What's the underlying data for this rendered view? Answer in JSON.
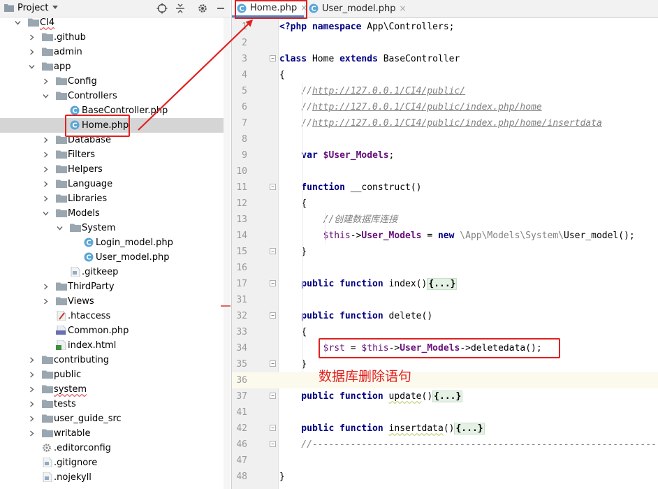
{
  "project_panel": {
    "title": "Project",
    "tree": [
      {
        "label": "CI4",
        "level": 1,
        "type": "folder",
        "arrow": "down",
        "wavy": true
      },
      {
        "label": ".github",
        "level": 2,
        "type": "folder",
        "arrow": "right"
      },
      {
        "label": "admin",
        "level": 2,
        "type": "folder",
        "arrow": "right"
      },
      {
        "label": "app",
        "level": 2,
        "type": "folder",
        "arrow": "down"
      },
      {
        "label": "Config",
        "level": 3,
        "type": "folder",
        "arrow": "right"
      },
      {
        "label": "Controllers",
        "level": 3,
        "type": "folder",
        "arrow": "down"
      },
      {
        "label": "BaseController.php",
        "level": 4,
        "type": "php-class"
      },
      {
        "label": "Home.php",
        "level": 4,
        "type": "php-class",
        "selected": true
      },
      {
        "label": "Database",
        "level": 3,
        "type": "folder",
        "arrow": "right"
      },
      {
        "label": "Filters",
        "level": 3,
        "type": "folder",
        "arrow": "right"
      },
      {
        "label": "Helpers",
        "level": 3,
        "type": "folder",
        "arrow": "right"
      },
      {
        "label": "Language",
        "level": 3,
        "type": "folder",
        "arrow": "right"
      },
      {
        "label": "Libraries",
        "level": 3,
        "type": "folder",
        "arrow": "right"
      },
      {
        "label": "Models",
        "level": 3,
        "type": "folder",
        "arrow": "down"
      },
      {
        "label": "System",
        "level": 4,
        "type": "folder",
        "arrow": "down"
      },
      {
        "label": "Login_model.php",
        "level": 5,
        "type": "php-class"
      },
      {
        "label": "User_model.php",
        "level": 5,
        "type": "php-class"
      },
      {
        "label": ".gitkeep",
        "level": 4,
        "type": "file"
      },
      {
        "label": "ThirdParty",
        "level": 3,
        "type": "folder",
        "arrow": "right"
      },
      {
        "label": "Views",
        "level": 3,
        "type": "folder",
        "arrow": "right"
      },
      {
        "label": ".htaccess",
        "level": 3,
        "type": "htaccess"
      },
      {
        "label": "Common.php",
        "level": 3,
        "type": "php-file"
      },
      {
        "label": "index.html",
        "level": 3,
        "type": "html-file"
      },
      {
        "label": "contributing",
        "level": 2,
        "type": "folder",
        "arrow": "right"
      },
      {
        "label": "public",
        "level": 2,
        "type": "folder",
        "arrow": "right"
      },
      {
        "label": "system",
        "level": 2,
        "type": "folder",
        "arrow": "right",
        "wavy": true
      },
      {
        "label": "tests",
        "level": 2,
        "type": "folder",
        "arrow": "right"
      },
      {
        "label": "user_guide_src",
        "level": 2,
        "type": "folder",
        "arrow": "right"
      },
      {
        "label": "writable",
        "level": 2,
        "type": "folder",
        "arrow": "right"
      },
      {
        "label": ".editorconfig",
        "level": 2,
        "type": "config"
      },
      {
        "label": ".gitignore",
        "level": 2,
        "type": "file"
      },
      {
        "label": ".nojekyll",
        "level": 2,
        "type": "file"
      }
    ]
  },
  "editor": {
    "tabs": [
      {
        "label": "Home.php",
        "active": true
      },
      {
        "label": "User_model.php",
        "active": false
      }
    ],
    "close_glyph": "×",
    "lines": [
      {
        "n": "1",
        "tokens": [
          [
            "kw",
            "<?php"
          ],
          [
            "",
            ""
          ],
          [
            "kw",
            " namespace"
          ],
          [
            "",
            " App\\Controllers;"
          ]
        ]
      },
      {
        "n": "2",
        "tokens": []
      },
      {
        "n": "3",
        "tokens": [
          [
            "kw",
            "class"
          ],
          [
            "",
            " Home "
          ],
          [
            "kw",
            "extends"
          ],
          [
            "",
            " BaseController"
          ]
        ],
        "fold": true
      },
      {
        "n": "4",
        "tokens": [
          [
            "",
            "{"
          ]
        ]
      },
      {
        "n": "5",
        "tokens": [
          [
            "cmt",
            "    //"
          ],
          [
            "cmt-url",
            "http://127.0.0.1/CI4/public/"
          ]
        ]
      },
      {
        "n": "6",
        "tokens": [
          [
            "cmt",
            "    //"
          ],
          [
            "cmt-url",
            "http://127.0.0.1/CI4/public/index.php/home"
          ]
        ]
      },
      {
        "n": "7",
        "tokens": [
          [
            "cmt",
            "    //"
          ],
          [
            "cmt-url",
            "http://127.0.0.1/CI4/public/index.php/home/insertdata"
          ]
        ]
      },
      {
        "n": "8",
        "tokens": []
      },
      {
        "n": "9",
        "tokens": [
          [
            "kw",
            "    var"
          ],
          [
            "",
            " "
          ],
          [
            "var-b",
            "$User_Models"
          ],
          [
            "",
            ";"
          ]
        ]
      },
      {
        "n": "10",
        "tokens": []
      },
      {
        "n": "11",
        "tokens": [
          [
            "kw",
            "    function"
          ],
          [
            "",
            " __construct()"
          ]
        ],
        "fold": true
      },
      {
        "n": "12",
        "tokens": [
          [
            "",
            "    {"
          ]
        ]
      },
      {
        "n": "13",
        "tokens": [
          [
            "cmt",
            "        //创建数据库连接"
          ]
        ]
      },
      {
        "n": "14",
        "tokens": [
          [
            "var",
            "        $this"
          ],
          [
            "",
            "->"
          ],
          [
            "prop",
            "User_Models"
          ],
          [
            "",
            " = "
          ],
          [
            "kw",
            "new"
          ],
          [
            "",
            " "
          ],
          [
            "plain-gray",
            "\\App\\Models\\System\\"
          ],
          [
            "",
            "User_model();"
          ]
        ]
      },
      {
        "n": "15",
        "tokens": [
          [
            "",
            "    }"
          ]
        ],
        "fold": true
      },
      {
        "n": "16",
        "tokens": []
      },
      {
        "n": "17",
        "tokens": [
          [
            "kw",
            "    public function"
          ],
          [
            "",
            " index()"
          ],
          [
            "fold-box",
            "{...}"
          ]
        ],
        "fold": true
      },
      {
        "n": "31",
        "tokens": []
      },
      {
        "n": "32",
        "tokens": [
          [
            "kw",
            "    public function"
          ],
          [
            "",
            " delete()"
          ]
        ],
        "fold": true
      },
      {
        "n": "33",
        "tokens": [
          [
            "",
            "    {"
          ]
        ]
      },
      {
        "n": "34",
        "tokens": [
          [
            "",
            "        "
          ],
          [
            "var",
            "$rst"
          ],
          [
            "",
            " = "
          ],
          [
            "var",
            "$this"
          ],
          [
            "",
            "->"
          ],
          [
            "prop",
            "User_Models"
          ],
          [
            "",
            "->deletedata();"
          ]
        ]
      },
      {
        "n": "35",
        "tokens": [
          [
            "",
            "    }"
          ]
        ],
        "fold": true
      },
      {
        "n": "36",
        "tokens": [],
        "current": true
      },
      {
        "n": "37",
        "tokens": [
          [
            "kw",
            "    public function"
          ],
          [
            "",
            " "
          ],
          [
            "unused",
            "update"
          ],
          [
            "",
            "()"
          ],
          [
            "fold-box",
            "{...}"
          ]
        ],
        "fold": true
      },
      {
        "n": "41",
        "tokens": []
      },
      {
        "n": "42",
        "tokens": [
          [
            "kw",
            "    public function"
          ],
          [
            "",
            " "
          ],
          [
            "unused",
            "insertdata"
          ],
          [
            "",
            "()"
          ],
          [
            "fold-box",
            "{...}"
          ]
        ],
        "fold": true
      },
      {
        "n": "46",
        "tokens": [
          [
            "cmt",
            "    //----------------------------------------------------------------"
          ]
        ],
        "fold": true
      },
      {
        "n": "47",
        "tokens": []
      },
      {
        "n": "48",
        "tokens": [
          [
            "",
            "}"
          ]
        ]
      }
    ]
  },
  "annotation": {
    "note": "数据库删除语句"
  },
  "colors": {
    "annotation_red": "#e02020",
    "keyword": "#000080",
    "field": "#660e7a",
    "comment": "#808080",
    "tab_underline": "#4a88c7"
  }
}
